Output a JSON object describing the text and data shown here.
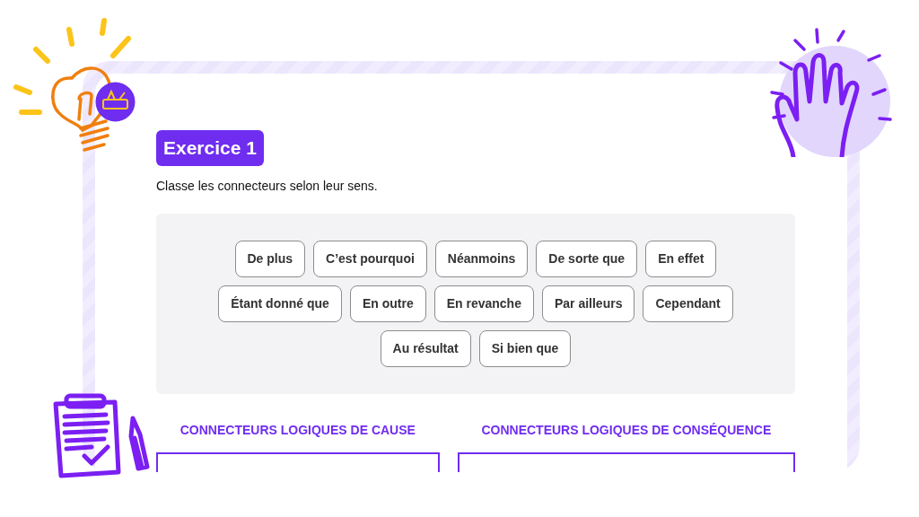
{
  "exercise": {
    "title": "Exercice 1",
    "instruction": "Classe les connecteurs selon leur sens."
  },
  "connectors": [
    "De plus",
    "C’est pourquoi",
    "Néanmoins",
    "De sorte que",
    "En effet",
    "Étant donné que",
    "En outre",
    "En revanche",
    "Par ailleurs",
    "Cependant",
    "Au résultat",
    "Si bien que"
  ],
  "categories": [
    {
      "title": "CONNECTEURS LOGIQUES DE CAUSE"
    },
    {
      "title": "CONNECTEURS LOGIQUES DE CONSÉQUENCE"
    }
  ]
}
